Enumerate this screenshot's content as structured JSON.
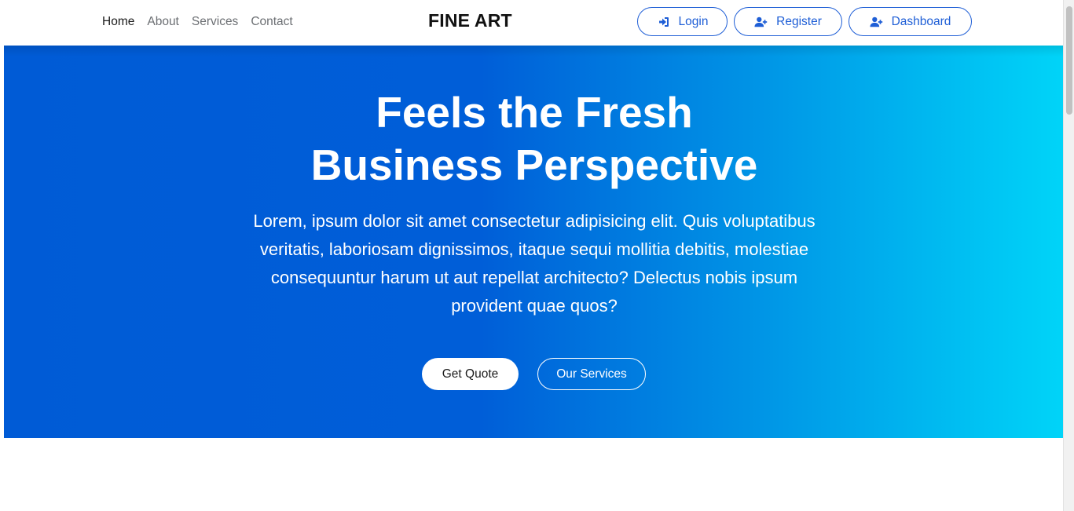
{
  "navbar": {
    "links": [
      "Home",
      "About",
      "Services",
      "Contact"
    ],
    "brand": "FINE ART",
    "login_label": "Login",
    "register_label": "Register",
    "dashboard_label": "Dashboard"
  },
  "hero": {
    "title": "Feels the Fresh Business Perspective",
    "text": "Lorem, ipsum dolor sit amet consectetur adipisicing elit. Quis voluptatibus veritatis, laboriosam dignissimos, itaque sequi mollitia debitis, molestiae consequuntur harum ut aut repellat architecto? Delectus nobis ipsum provident quae quos?",
    "quote_button": "Get Quote",
    "services_button": "Our Services"
  },
  "icons": {
    "login": "sign-in-icon",
    "register": "user-plus-icon",
    "dashboard": "user-plus-icon"
  },
  "colors": {
    "accent": "#1e5ed6",
    "hero_gradient_start": "#005bd6",
    "hero_gradient_end": "#00d4f8"
  }
}
